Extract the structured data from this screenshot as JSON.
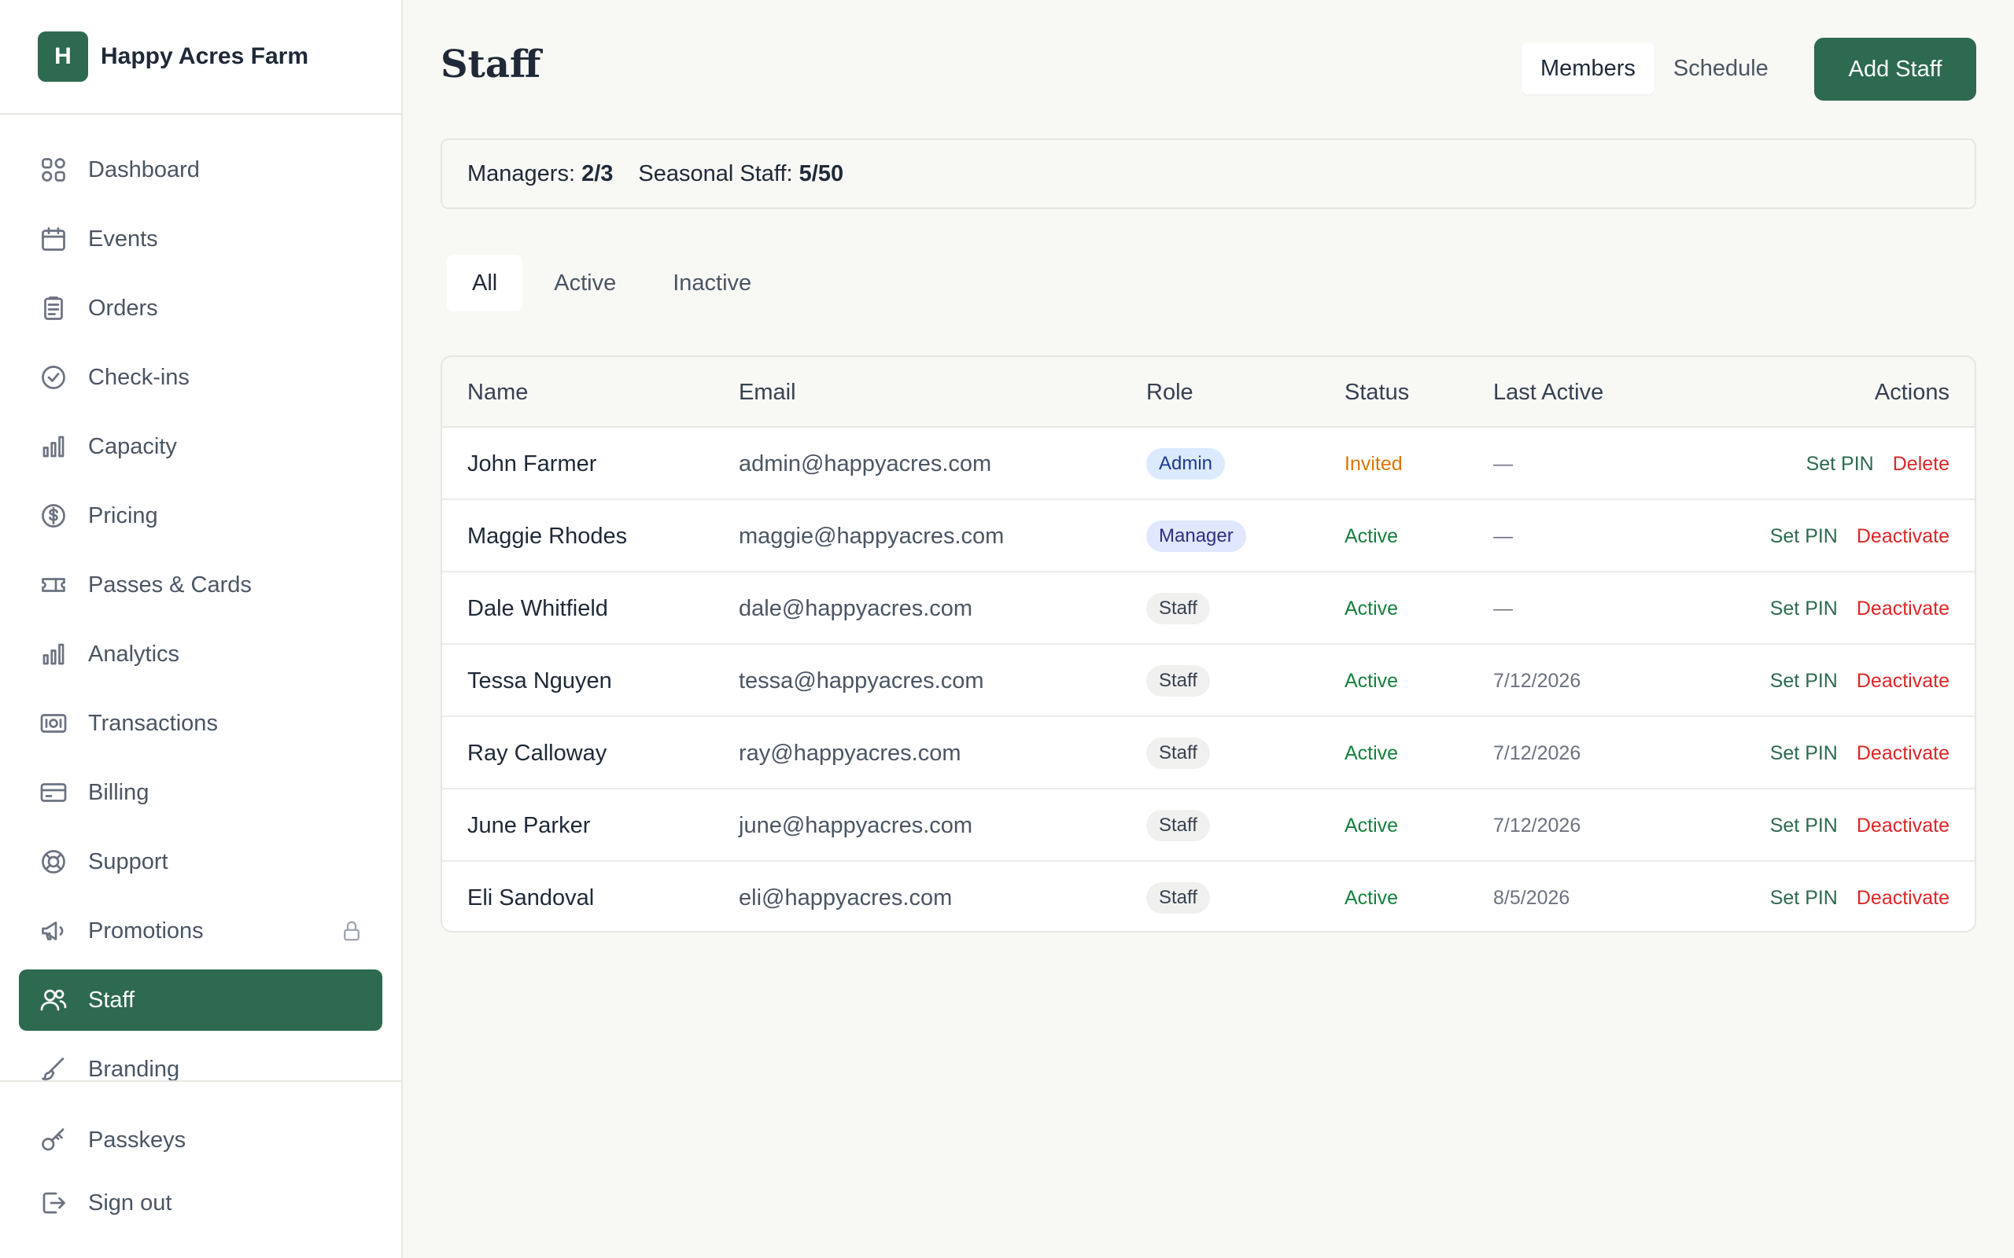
{
  "brand": {
    "logo_letter": "H",
    "name": "Happy Acres Farm"
  },
  "nav": {
    "items": [
      {
        "label": "Dashboard",
        "icon": "dashboard-grid-icon"
      },
      {
        "label": "Events",
        "icon": "calendar-icon"
      },
      {
        "label": "Orders",
        "icon": "clipboard-icon"
      },
      {
        "label": "Check-ins",
        "icon": "check-circle-icon"
      },
      {
        "label": "Capacity",
        "icon": "bar-chart-icon"
      },
      {
        "label": "Pricing",
        "icon": "dollar-circle-icon"
      },
      {
        "label": "Passes & Cards",
        "icon": "ticket-icon"
      },
      {
        "label": "Analytics",
        "icon": "bar-chart-icon"
      },
      {
        "label": "Transactions",
        "icon": "banknote-icon"
      },
      {
        "label": "Billing",
        "icon": "credit-card-icon"
      },
      {
        "label": "Support",
        "icon": "lifebuoy-icon"
      },
      {
        "label": "Promotions",
        "icon": "megaphone-icon",
        "locked": true
      },
      {
        "label": "Staff",
        "icon": "users-icon",
        "active": true
      },
      {
        "label": "Branding",
        "icon": "brush-icon"
      }
    ],
    "footer": [
      {
        "label": "Passkeys",
        "icon": "key-icon"
      },
      {
        "label": "Sign out",
        "icon": "sign-out-icon"
      }
    ]
  },
  "header": {
    "title": "Staff",
    "views": [
      "Members",
      "Schedule"
    ],
    "active_view": "Members",
    "add_button": "Add Staff"
  },
  "counts": {
    "managers_label": "Managers:",
    "managers_value": "2/3",
    "seasonal_label": "Seasonal Staff:",
    "seasonal_value": "5/50"
  },
  "filters": {
    "tabs": [
      "All",
      "Active",
      "Inactive"
    ],
    "active": "All"
  },
  "table": {
    "columns": [
      "Name",
      "Email",
      "Role",
      "Status",
      "Last Active",
      "Actions"
    ],
    "rows": [
      {
        "name": "John Farmer",
        "email": "admin@happyacres.com",
        "role": "Admin",
        "status": "Invited",
        "last_active": "—",
        "actions": [
          "Set PIN",
          "Delete"
        ]
      },
      {
        "name": "Maggie Rhodes",
        "email": "maggie@happyacres.com",
        "role": "Manager",
        "status": "Active",
        "last_active": "—",
        "actions": [
          "Set PIN",
          "Deactivate"
        ]
      },
      {
        "name": "Dale Whitfield",
        "email": "dale@happyacres.com",
        "role": "Staff",
        "status": "Active",
        "last_active": "—",
        "actions": [
          "Set PIN",
          "Deactivate"
        ]
      },
      {
        "name": "Tessa Nguyen",
        "email": "tessa@happyacres.com",
        "role": "Staff",
        "status": "Active",
        "last_active": "7/12/2026",
        "actions": [
          "Set PIN",
          "Deactivate"
        ]
      },
      {
        "name": "Ray Calloway",
        "email": "ray@happyacres.com",
        "role": "Staff",
        "status": "Active",
        "last_active": "7/12/2026",
        "actions": [
          "Set PIN",
          "Deactivate"
        ]
      },
      {
        "name": "June Parker",
        "email": "june@happyacres.com",
        "role": "Staff",
        "status": "Active",
        "last_active": "7/12/2026",
        "actions": [
          "Set PIN",
          "Deactivate"
        ]
      },
      {
        "name": "Eli Sandoval",
        "email": "eli@happyacres.com",
        "role": "Staff",
        "status": "Active",
        "last_active": "8/5/2026",
        "actions": [
          "Set PIN",
          "Deactivate"
        ]
      }
    ]
  },
  "colors": {
    "brand_green": "#2d6a4f",
    "invited": "#d97706",
    "active": "#15803d",
    "danger": "#dc2626"
  }
}
